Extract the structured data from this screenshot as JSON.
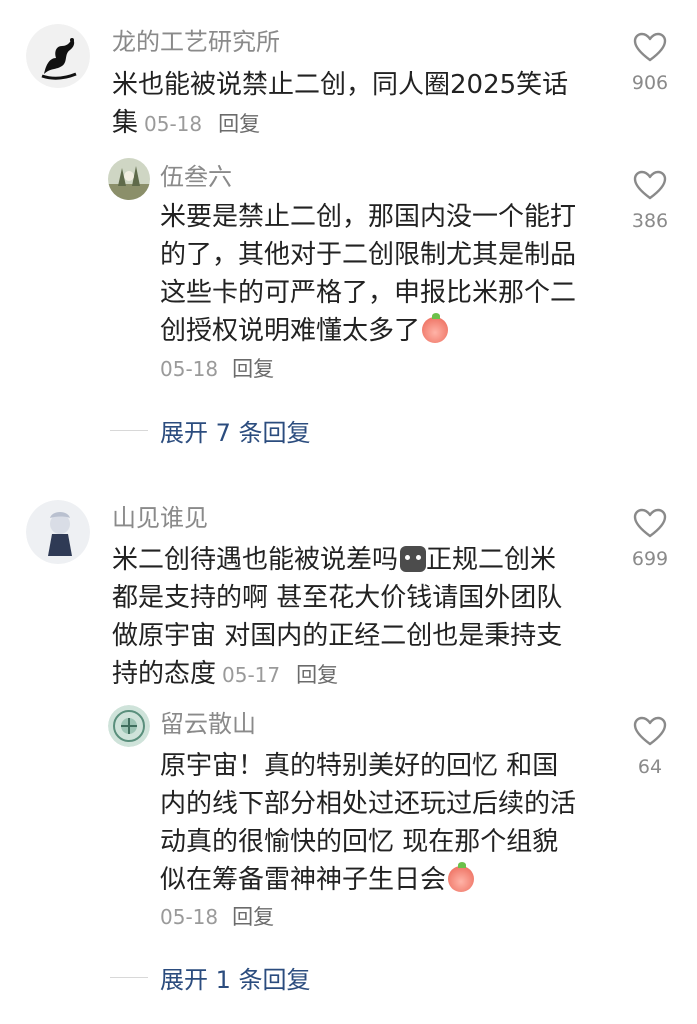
{
  "comments": [
    {
      "author": "龙的工艺研究所",
      "text_lines": [
        "米也能被说禁止二创，同人圈2025笑话",
        "集"
      ],
      "date": "05-18",
      "reply_label": "回复",
      "likes": "906",
      "replies": [
        {
          "author": "伍叁六",
          "text_lines": [
            "米要是禁止二创，那国内没一个能打",
            "的了，其他对于二创限制尤其是制品",
            "这些卡的可严格了，申报比米那个二",
            "创授权说明难懂太多了"
          ],
          "date": "05-18",
          "reply_label": "回复",
          "likes": "386"
        }
      ],
      "expand_label": "展开 7 条回复"
    },
    {
      "author": "山见谁见",
      "text_lines": [
        "米二创待遇也能被说差吗",
        "正规二创米",
        "都是支持的啊 甚至花大价钱请国外团队",
        "做原宇宙 对国内的正经二创也是秉持支",
        "持的态度"
      ],
      "date": "05-17",
      "reply_label": "回复",
      "likes": "699",
      "replies": [
        {
          "author": "留云散山",
          "text_lines": [
            "原宇宙！真的特别美好的回忆 和国",
            "内的线下部分相处过还玩过后续的活",
            "动真的很愉快的回忆 现在那个组貌",
            "似在筹备雷神神子生日会"
          ],
          "date": "05-18",
          "reply_label": "回复",
          "likes": "64"
        }
      ],
      "expand_label": "展开 1 条回复"
    }
  ],
  "icons": {
    "like": "heart-outline-icon",
    "emoji_peach": "crying-peach-emoji",
    "emoji_cat": "cat-face-emoji"
  }
}
